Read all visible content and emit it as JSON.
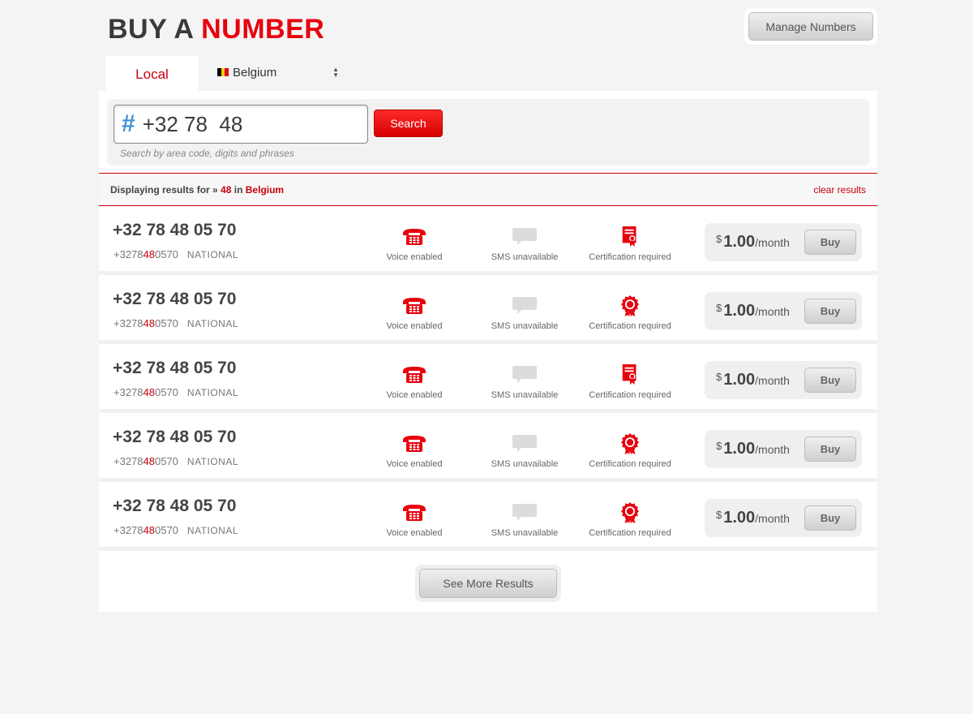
{
  "header": {
    "title_part1": "BUY A",
    "title_part2": "NUMBER",
    "manage_label": "Manage Numbers"
  },
  "tabs": {
    "local_label": "Local",
    "country": "Belgium"
  },
  "search": {
    "hash_symbol": "#",
    "value": "+32 78  48",
    "button_label": "Search",
    "hint": "Search by area code, digits and phrases"
  },
  "results_bar": {
    "prefix": "Displaying results for »",
    "query": "48",
    "in_word": "in",
    "country": "Belgium",
    "clear_label": "clear results"
  },
  "results": [
    {
      "number": "+32 78 48 05 70",
      "raw_before": "+3278",
      "raw_match": "48",
      "raw_after": "0570",
      "type": "NATIONAL",
      "voice": "Voice enabled",
      "sms": "SMS unavailable",
      "cert": "Certification required",
      "cert_icon": "document-icon",
      "currency": "$",
      "price": "1.00",
      "period": "/month",
      "buy_label": "Buy"
    },
    {
      "number": "+32 78 48 05 70",
      "raw_before": "+3278",
      "raw_match": "48",
      "raw_after": "0570",
      "type": "NATIONAL",
      "voice": "Voice enabled",
      "sms": "SMS unavailable",
      "cert": "Certification required",
      "cert_icon": "badge-icon",
      "currency": "$",
      "price": "1.00",
      "period": "/month",
      "buy_label": "Buy"
    },
    {
      "number": "+32 78 48 05 70",
      "raw_before": "+3278",
      "raw_match": "48",
      "raw_after": "0570",
      "type": "NATIONAL",
      "voice": "Voice enabled",
      "sms": "SMS unavailable",
      "cert": "Certification required",
      "cert_icon": "document-icon",
      "currency": "$",
      "price": "1.00",
      "period": "/month",
      "buy_label": "Buy"
    },
    {
      "number": "+32 78 48 05 70",
      "raw_before": "+3278",
      "raw_match": "48",
      "raw_after": "0570",
      "type": "NATIONAL",
      "voice": "Voice enabled",
      "sms": "SMS unavailable",
      "cert": "Certification required",
      "cert_icon": "badge-icon",
      "currency": "$",
      "price": "1.00",
      "period": "/month",
      "buy_label": "Buy"
    },
    {
      "number": "+32 78 48 05 70",
      "raw_before": "+3278",
      "raw_match": "48",
      "raw_after": "0570",
      "type": "NATIONAL",
      "voice": "Voice enabled",
      "sms": "SMS unavailable",
      "cert": "Certification required",
      "cert_icon": "badge-icon",
      "currency": "$",
      "price": "1.00",
      "period": "/month",
      "buy_label": "Buy"
    }
  ],
  "see_more_label": "See More Results",
  "colors": {
    "accent": "#e8000d",
    "link": "#c8000b",
    "hash": "#3f8fd6"
  }
}
